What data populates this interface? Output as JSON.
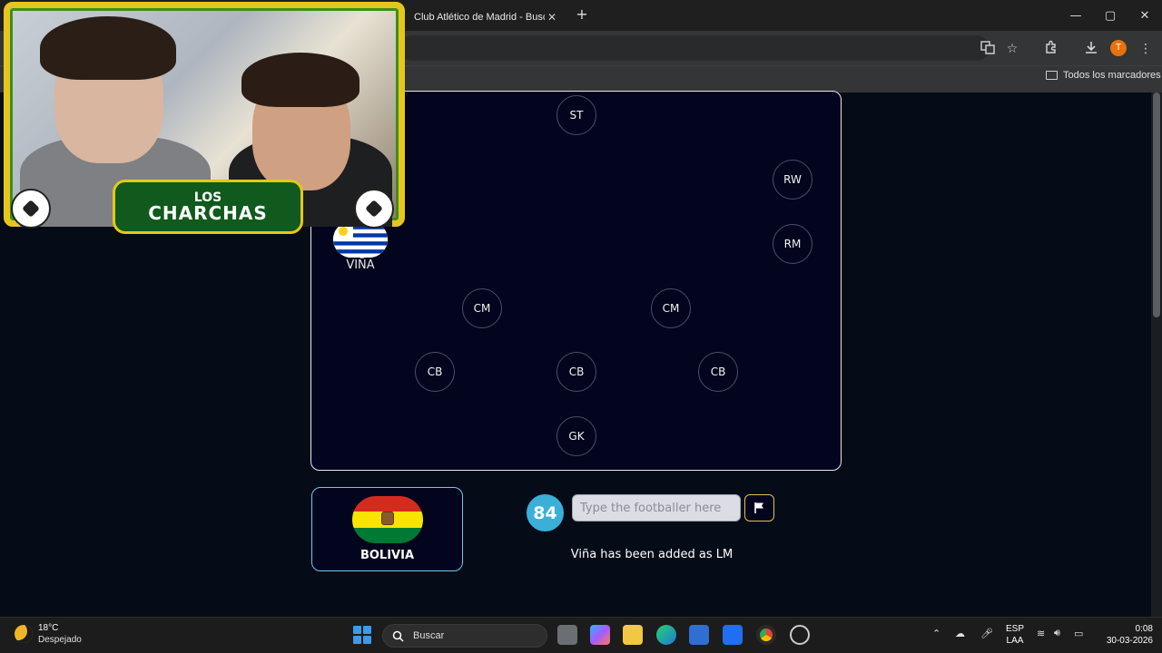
{
  "browser": {
    "tab_title": "Club Atlético de Madrid - Buscar",
    "tab_close": "✕",
    "new_tab": "+",
    "bookmarks_folder": "Todos los marcadores",
    "profile_initial": "T",
    "window_controls": {
      "minimize": "—",
      "maximize": "▢",
      "close": "✕"
    }
  },
  "overlay": {
    "banner_line1": "LOS",
    "banner_line2": "CHARCHAS"
  },
  "pitch": {
    "positions": [
      "ST",
      "RW",
      "RM",
      "CM",
      "CM",
      "CB",
      "CB",
      "CB",
      "GK"
    ],
    "placed_player": {
      "name": "VIÑA",
      "country_flag": "uruguay"
    }
  },
  "game": {
    "country_name": "BOLIVIA",
    "country_flag": "bolivia",
    "score": "84",
    "input_placeholder": "Type the footballer here",
    "input_value": "",
    "status_message": "Viña has been added as LM"
  },
  "taskbar": {
    "temperature": "18°C",
    "weather": "Despejado",
    "search_label": "Buscar",
    "language": "ESP",
    "layout": "LAA",
    "time": "0:08",
    "date": "30-03-2026"
  },
  "colors": {
    "pitch_bg": "#02051d",
    "accent_cyan": "#3ab0d8",
    "flag_button_border": "#e2c24a"
  }
}
